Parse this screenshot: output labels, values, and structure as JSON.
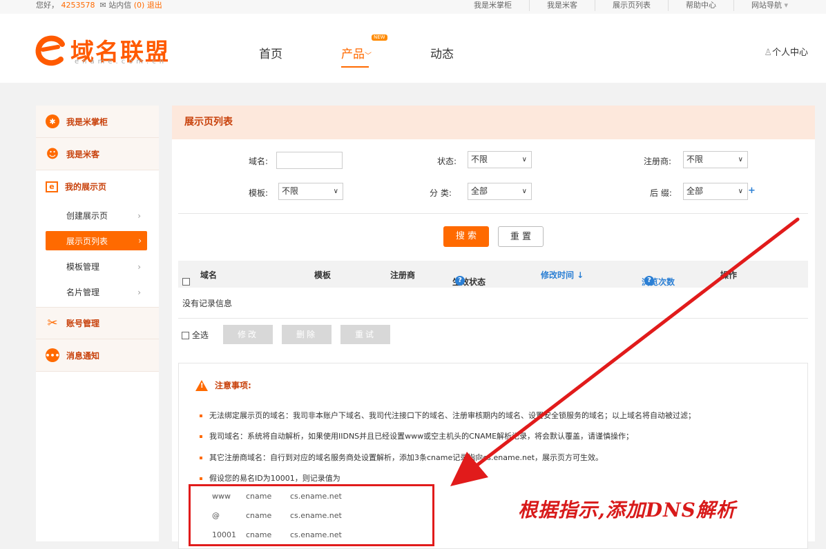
{
  "topbar": {
    "greeting": "您好，",
    "user_id": "4253578",
    "mail_label": "站内信",
    "mail_count": "(0)",
    "logout": "退出",
    "links": [
      "我是米掌柜",
      "我是米客",
      "展示页列表",
      "帮助中心",
      "网站导航"
    ]
  },
  "header": {
    "logo_cn": "域名联盟",
    "logo_en": "ename.com.cn",
    "nav": [
      "首页",
      "产品",
      "动态"
    ],
    "new_badge": "NEW",
    "user_center": "个人中心"
  },
  "sidebar": {
    "sections": [
      {
        "label": "我是米掌柜"
      },
      {
        "label": "我是米客"
      },
      {
        "label": "我的展示页"
      }
    ],
    "sub_items": [
      "创建展示页",
      "展示页列表",
      "模板管理",
      "名片管理"
    ],
    "sections2": [
      {
        "label": "账号管理"
      },
      {
        "label": "消息通知"
      }
    ]
  },
  "main": {
    "title": "展示页列表",
    "filters": {
      "domain_label": "域名:",
      "status_label": "状态:",
      "status_value": "不限",
      "registrar_label": "注册商:",
      "registrar_value": "不限",
      "template_label": "模板:",
      "template_value": "不限",
      "category_label": "分 类:",
      "category_value": "全部",
      "suffix_label": "后 缀:",
      "suffix_value": "全部"
    },
    "search_button": "搜 索",
    "reset_button": "重 置",
    "table_headers": [
      "域名",
      "模板",
      "注册商",
      "生效状态",
      "修改时间 ↓",
      "浏览次数",
      "操作"
    ],
    "empty_text": "没有记录信息",
    "select_all": "全选",
    "bulk_buttons": [
      "修改",
      "删除",
      "重试"
    ]
  },
  "notice": {
    "title": "注意事项:",
    "items": [
      "无法绑定展示页的域名：我司非本账户下域名、我司代注接口下的域名、注册审核期内的域名、设置安全锁服务的域名；以上域名将自动被过滤；",
      "我司域名：系统将自动解析，如果使用IIDNS并且已经设置www或空主机头的CNAME解析记录，将会默认覆盖，请谨慎操作；",
      "其它注册商域名：自行到对应的域名服务商处设置解析，添加3条cname记录指向cs.ename.net，展示页方可生效。",
      "假设您的易名ID为10001，则记录值为"
    ],
    "records": [
      {
        "host": "www",
        "type": "cname",
        "value": "cs.ename.net"
      },
      {
        "host": "@",
        "type": "cname",
        "value": "cs.ename.net"
      },
      {
        "host": "10001",
        "type": "cname",
        "value": "cs.ename.net"
      }
    ]
  },
  "annotation": {
    "text": "根据指示,添加DNS解析",
    "color": "#d81a1a"
  },
  "colors": {
    "accent": "#ff6a00",
    "link": "#2b7fd4"
  }
}
